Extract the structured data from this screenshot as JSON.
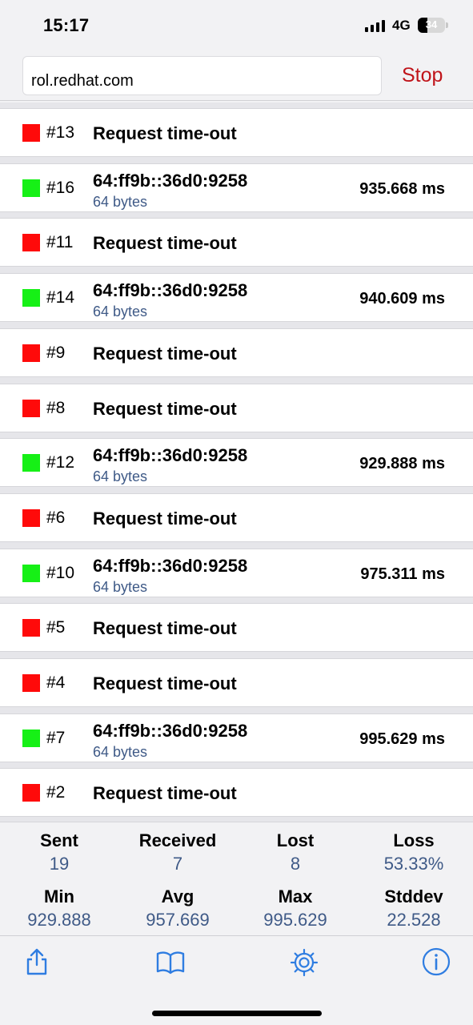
{
  "status_bar": {
    "time": "15:17",
    "network": "4G",
    "battery": "34",
    "battery_level": 0.34
  },
  "header": {
    "url": "rol.redhat.com",
    "stop_label": "Stop"
  },
  "colors": {
    "success": "#16f016",
    "timeout": "#ff0a0a",
    "accent_blue": "#2f7de1",
    "stop_red": "#c0141a"
  },
  "pings": [
    {
      "status": "timeout",
      "seq": "#13",
      "title": "Request time-out",
      "sub": "",
      "time": ""
    },
    {
      "status": "ok",
      "seq": "#16",
      "title": "64:ff9b::36d0:9258",
      "sub": "64 bytes",
      "time": "935.668 ms"
    },
    {
      "status": "timeout",
      "seq": "#11",
      "title": "Request time-out",
      "sub": "",
      "time": ""
    },
    {
      "status": "ok",
      "seq": "#14",
      "title": "64:ff9b::36d0:9258",
      "sub": "64 bytes",
      "time": "940.609 ms"
    },
    {
      "status": "timeout",
      "seq": "#9",
      "title": "Request time-out",
      "sub": "",
      "time": ""
    },
    {
      "status": "timeout",
      "seq": "#8",
      "title": "Request time-out",
      "sub": "",
      "time": ""
    },
    {
      "status": "ok",
      "seq": "#12",
      "title": "64:ff9b::36d0:9258",
      "sub": "64 bytes",
      "time": "929.888 ms"
    },
    {
      "status": "timeout",
      "seq": "#6",
      "title": "Request time-out",
      "sub": "",
      "time": ""
    },
    {
      "status": "ok",
      "seq": "#10",
      "title": "64:ff9b::36d0:9258",
      "sub": "64 bytes",
      "time": "975.311 ms"
    },
    {
      "status": "timeout",
      "seq": "#5",
      "title": "Request time-out",
      "sub": "",
      "time": ""
    },
    {
      "status": "timeout",
      "seq": "#4",
      "title": "Request time-out",
      "sub": "",
      "time": ""
    },
    {
      "status": "ok",
      "seq": "#7",
      "title": "64:ff9b::36d0:9258",
      "sub": "64 bytes",
      "time": "995.629 ms"
    },
    {
      "status": "timeout",
      "seq": "#2",
      "title": "Request time-out",
      "sub": "",
      "time": ""
    }
  ],
  "stats": {
    "sent": {
      "label": "Sent",
      "value": "19"
    },
    "received": {
      "label": "Received",
      "value": "7"
    },
    "lost": {
      "label": "Lost",
      "value": "8"
    },
    "loss": {
      "label": "Loss",
      "value": "53.33%"
    },
    "min": {
      "label": "Min",
      "value": "929.888"
    },
    "avg": {
      "label": "Avg",
      "value": "957.669"
    },
    "max": {
      "label": "Max",
      "value": "995.629"
    },
    "stddev": {
      "label": "Stddev",
      "value": "22.528"
    }
  },
  "tabbar": {
    "icons": [
      "share-icon",
      "book-icon",
      "gear-icon",
      "info-icon"
    ]
  }
}
